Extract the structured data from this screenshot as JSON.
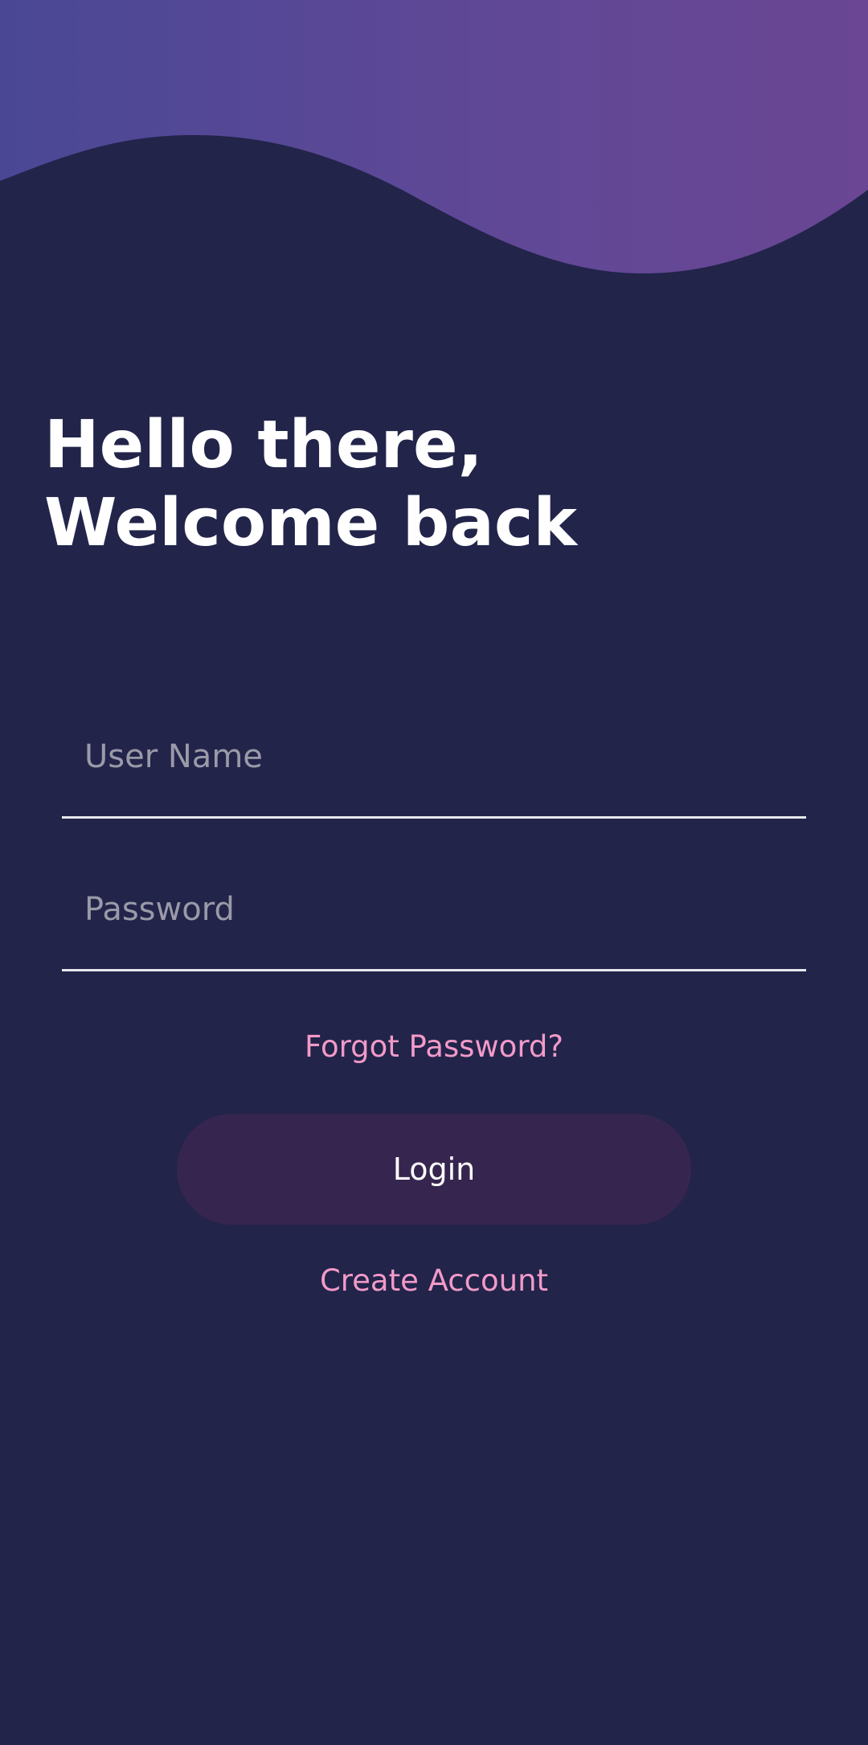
{
  "greeting": {
    "line1": "Hello there,",
    "line2": "Welcome back"
  },
  "form": {
    "username_placeholder": "User Name",
    "username_value": "",
    "password_placeholder": "Password",
    "password_value": ""
  },
  "links": {
    "forgot_password": "Forgot Password?",
    "create_account": "Create Account"
  },
  "buttons": {
    "login": "Login"
  },
  "colors": {
    "background": "#22244a",
    "header_gradient_start": "#4a4895",
    "header_gradient_end": "#6a4694",
    "link_pink": "#f29ac8",
    "button_bg": "#36264f",
    "field_underline": "#e8e8ef",
    "placeholder": "#9a9aa8"
  }
}
